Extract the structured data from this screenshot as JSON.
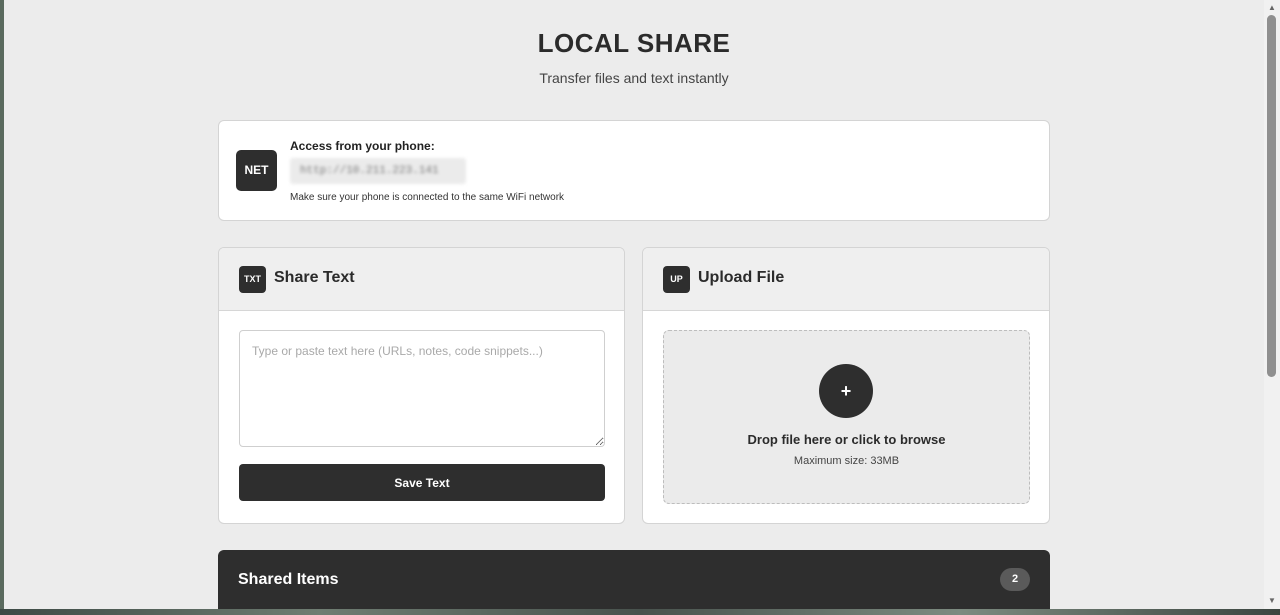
{
  "header": {
    "title": "LOCAL SHARE",
    "subtitle": "Transfer files and text instantly"
  },
  "network": {
    "icon_text": "NET",
    "label": "Access from your phone:",
    "url": "http://10.211.223.141",
    "hint": "Make sure your phone is connected to the same WiFi network"
  },
  "share_text": {
    "icon_text": "TXT",
    "title": "Share Text",
    "placeholder": "Type or paste text here (URLs, notes, code snippets...)",
    "value": "",
    "save_label": "Save Text"
  },
  "upload": {
    "icon_text": "UP",
    "title": "Upload File",
    "plus": "+",
    "drop_text": "Drop file here or click to browse",
    "max_size": "Maximum size: 33MB"
  },
  "shared_items": {
    "title": "Shared Items",
    "count": "2"
  },
  "icons": {
    "scroll_up": "scroll-up-arrow-icon",
    "scroll_down": "scroll-down-arrow-icon",
    "plus": "plus-icon"
  },
  "colors": {
    "accent": "#2e2e2e",
    "background": "#ececec",
    "card": "#ffffff"
  }
}
